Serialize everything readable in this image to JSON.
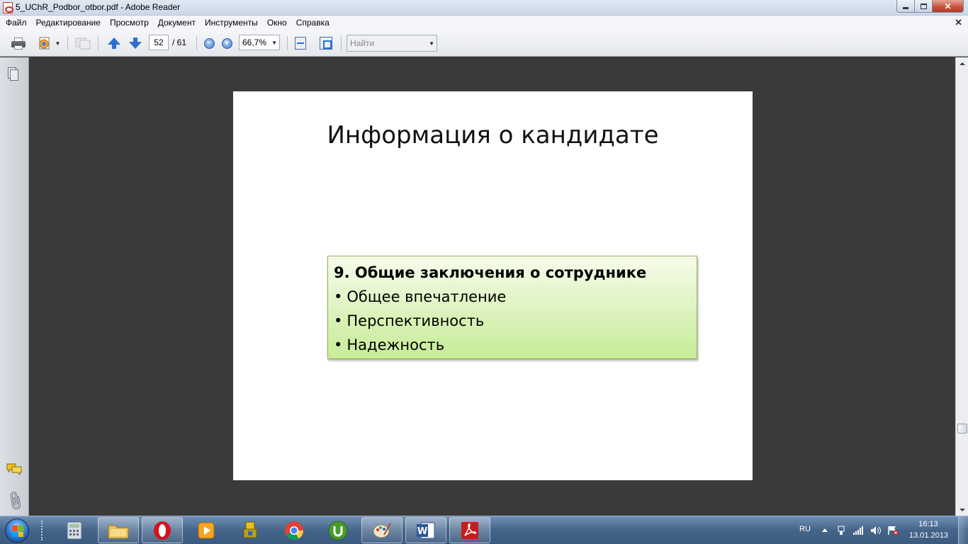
{
  "window": {
    "title": "5_UChR_Podbor_otbor.pdf - Adobe Reader"
  },
  "menu": {
    "items": [
      "Файл",
      "Редактирование",
      "Просмотр",
      "Документ",
      "Инструменты",
      "Окно",
      "Справка"
    ]
  },
  "toolbar": {
    "current_page": "52",
    "page_total": "/ 61",
    "zoom": "66,7%",
    "search_placeholder": "Найти"
  },
  "slide": {
    "title": "Информация о кандидате",
    "box": {
      "heading": "9. Общие заключения о сотруднике",
      "bullet_char": "•",
      "items": [
        "Общее впечатление",
        "Перспективность",
        "Надежность"
      ]
    }
  },
  "taskbar": {
    "apps": [
      "calculator-icon",
      "explorer-icon",
      "opera-icon",
      "media-player-icon",
      "game-icon",
      "chrome-icon",
      "utorrent-icon",
      "paint-icon",
      "word-icon",
      "adobe-reader-icon"
    ]
  },
  "tray": {
    "language": "RU",
    "time": "16:13",
    "date": "13.01.2013"
  },
  "colors": {
    "box_top": "#f7fbea",
    "box_bottom": "#c6ec98",
    "doc_background": "#3a3a3a"
  }
}
